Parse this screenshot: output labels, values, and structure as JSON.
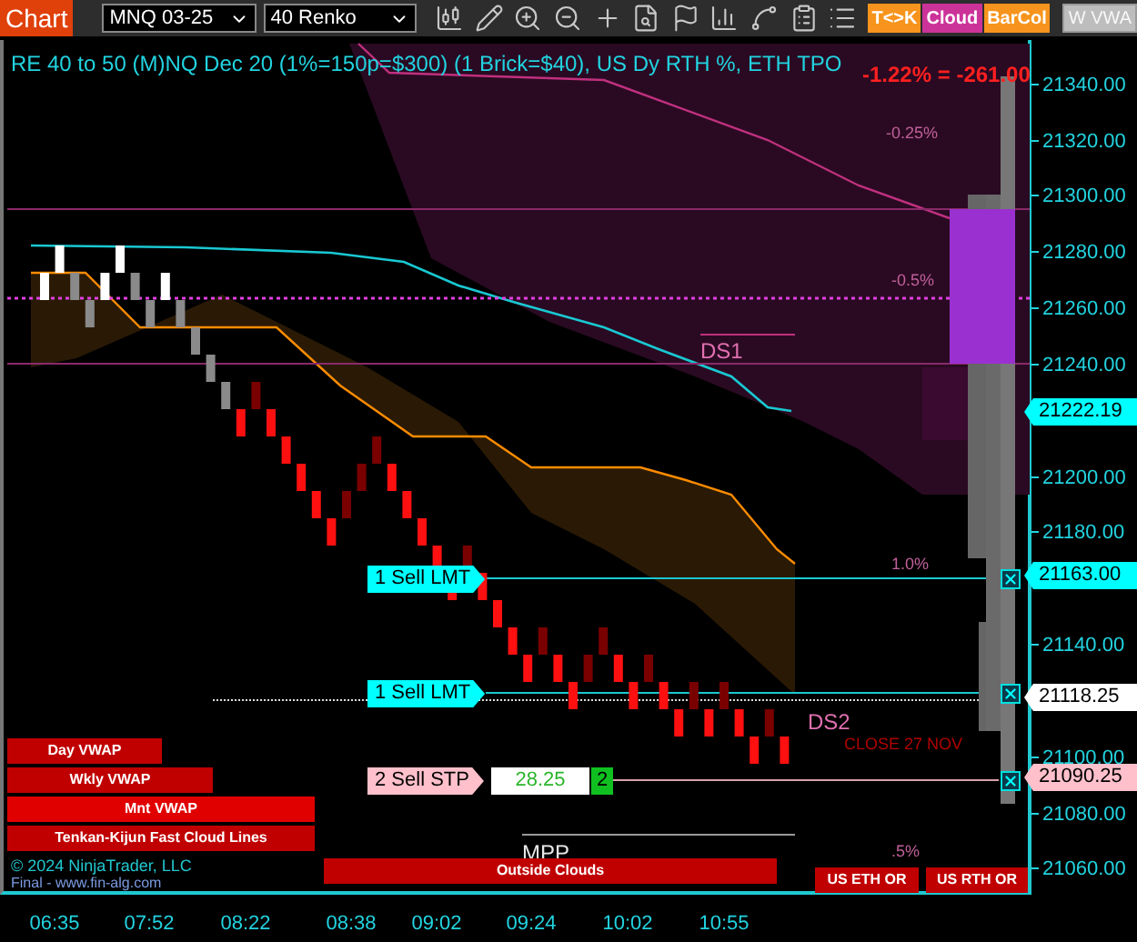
{
  "toolbar": {
    "title": "Chart",
    "instrument": "MNQ 03-25",
    "bar_type": "40 Renko",
    "toggles": [
      {
        "label": "T<>K",
        "color": "#f7941d",
        "on": true
      },
      {
        "label": "Cloud",
        "color": "#cc3399",
        "on": true
      },
      {
        "label": "BarCol",
        "color": "#f7941d",
        "on": true
      },
      {
        "label": "W VWA",
        "color": "#bdbdbd",
        "on": false
      }
    ]
  },
  "chart": {
    "title": "RE 40 to 50 (M)NQ Dec 20 (1%=150p=$300) (1 Brick=$40), US Dy RTH %, ETH TPO",
    "change": "-1.22% = -261.00",
    "level_labels": [
      "-0.25%",
      "-0.5%",
      "1.0%",
      "CLOSE 27 NOV",
      ".5%"
    ],
    "markers": [
      "DS1",
      "DS2",
      "MPP"
    ],
    "orders": [
      {
        "kind": "limit",
        "label": "1 Sell LMT"
      },
      {
        "kind": "limit",
        "label": "1 Sell LMT"
      },
      {
        "kind": "stop",
        "label": "2 Sell STP",
        "value": "28.25",
        "quantity": "2"
      }
    ],
    "study_labels": [
      "Day VWAP",
      "Wkly VWAP",
      "Mnt VWAP",
      "Tenkan-Kijun Fast Cloud Lines",
      "Outside Clouds",
      "US ETH OR",
      "US RTH OR"
    ],
    "copyright": "© 2024 NinjaTrader, LLC",
    "credit": "Final - www.fin-alg.com"
  },
  "price_axis": {
    "ticks": [
      "21340.00",
      "21320.00",
      "21300.00",
      "21280.00",
      "21260.00",
      "21240.00",
      "21200.00",
      "21180.00",
      "21140.00",
      "21100.00",
      "21080.00",
      "21060.00"
    ],
    "tags": [
      {
        "kind": "last",
        "text": "21222.19"
      },
      {
        "kind": "limit",
        "text": "21163.00"
      },
      {
        "kind": "position",
        "text": "21118.25"
      },
      {
        "kind": "stop",
        "text": "21090.25"
      }
    ]
  },
  "time_axis": [
    "06:35",
    "07:52",
    "08:22",
    "08:38",
    "09:02",
    "09:24",
    "10:02",
    "10:55"
  ]
}
